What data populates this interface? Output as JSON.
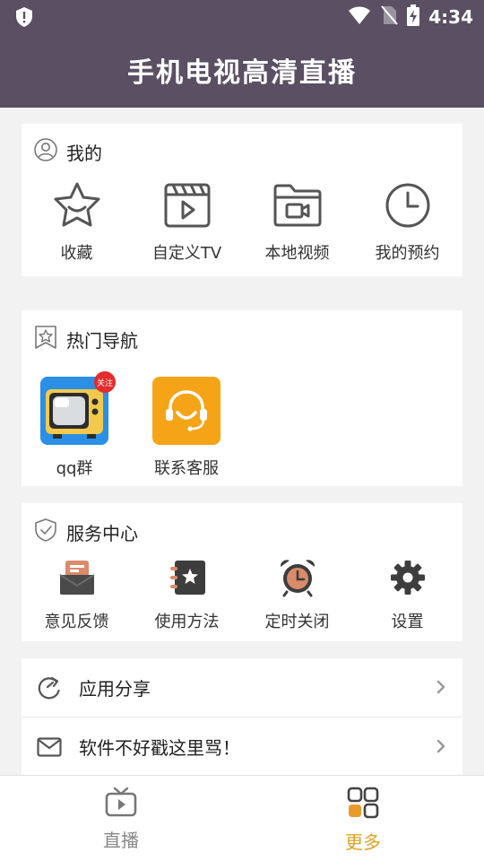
{
  "status": {
    "time": "4:34"
  },
  "app": {
    "title": "手机电视高清直播"
  },
  "mine": {
    "title": "我的",
    "items": [
      {
        "label": "收藏",
        "icon": "star-icon"
      },
      {
        "label": "自定义TV",
        "icon": "clapperboard-icon"
      },
      {
        "label": "本地视频",
        "icon": "video-folder-icon"
      },
      {
        "label": "我的预约",
        "icon": "clock-icon"
      }
    ]
  },
  "hot": {
    "title": "热门导航",
    "items": [
      {
        "label": "qq群",
        "icon": "retro-tv-icon",
        "badge": "关注"
      },
      {
        "label": "联系客服",
        "icon": "headset-icon"
      }
    ]
  },
  "service": {
    "title": "服务中心",
    "items": [
      {
        "label": "意见反馈",
        "icon": "feedback-icon"
      },
      {
        "label": "使用方法",
        "icon": "guide-book-icon"
      },
      {
        "label": "定时关闭",
        "icon": "alarm-clock-icon"
      },
      {
        "label": "设置",
        "icon": "gear-icon"
      }
    ]
  },
  "list": [
    {
      "label": "应用分享",
      "icon": "share-icon"
    },
    {
      "label": "软件不好戳这里骂！",
      "icon": "mail-icon"
    }
  ],
  "tabs": [
    {
      "label": "直播",
      "icon": "tv-play-icon",
      "active": false
    },
    {
      "label": "更多",
      "icon": "grid-icon",
      "active": true
    }
  ],
  "colors": {
    "header": "#5b4f63",
    "accent": "#d9a425",
    "icon": "#555555",
    "orange": "#f5a417"
  }
}
